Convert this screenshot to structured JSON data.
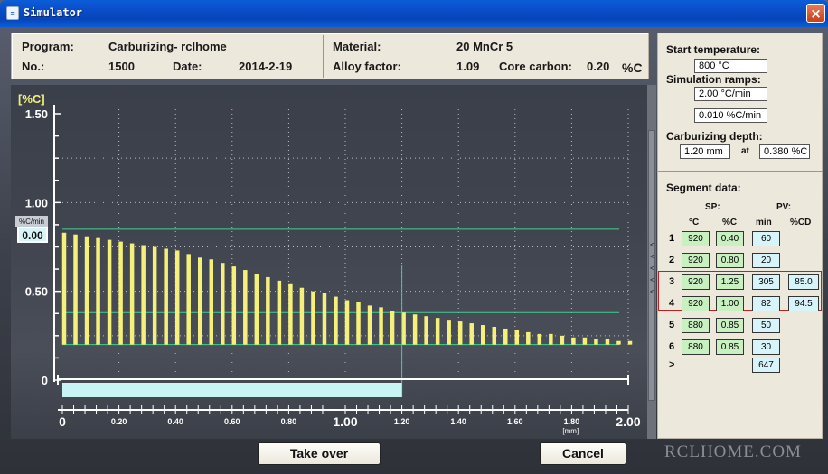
{
  "window": {
    "title": "Simulator",
    "close_glyph": "×"
  },
  "program_info": {
    "program_label": "Program:",
    "program_value": "Carburizing- rclhome",
    "no_label": "No.:",
    "no_value": "1500",
    "date_label": "Date:",
    "date_value": "2014-2-19",
    "material_label": "Material:",
    "material_value": "20 MnCr 5",
    "alloy_label": "Alloy factor:",
    "alloy_value": "1.09",
    "core_label": "Core carbon:",
    "core_value": "0.20",
    "core_unit": "%C"
  },
  "chart_data": {
    "type": "bar",
    "ylabel": "[%C]",
    "xlabel": "[mm]",
    "ylim": [
      0,
      1.5
    ],
    "xlim": [
      0,
      2.0
    ],
    "yticks": [
      "0",
      "0.50",
      "1.00",
      "1.50"
    ],
    "xticks": [
      "0",
      "0.20",
      "0.40",
      "0.60",
      "0.80",
      "1.00",
      "1.20",
      "1.40",
      "1.60",
      "1.80",
      "2.00"
    ],
    "rate_label": "%C/min",
    "rate_value": "0.00",
    "bars_x": [
      0.0,
      0.04,
      0.08,
      0.12,
      0.16,
      0.2,
      0.24,
      0.28,
      0.32,
      0.36,
      0.4,
      0.44,
      0.48,
      0.52,
      0.56,
      0.6,
      0.64,
      0.68,
      0.72,
      0.76,
      0.8,
      0.84,
      0.88,
      0.92,
      0.96,
      1.0,
      1.04,
      1.08,
      1.12,
      1.16,
      1.2,
      1.24,
      1.28,
      1.32,
      1.36,
      1.4,
      1.44,
      1.48,
      1.52,
      1.56,
      1.6,
      1.64,
      1.68,
      1.72,
      1.76,
      1.8,
      1.84,
      1.88,
      1.92,
      1.96,
      2.0
    ],
    "bars_y": [
      0.83,
      0.82,
      0.81,
      0.8,
      0.79,
      0.78,
      0.77,
      0.76,
      0.75,
      0.74,
      0.73,
      0.71,
      0.69,
      0.68,
      0.66,
      0.64,
      0.62,
      0.6,
      0.58,
      0.56,
      0.54,
      0.52,
      0.5,
      0.49,
      0.47,
      0.45,
      0.44,
      0.42,
      0.41,
      0.39,
      0.38,
      0.37,
      0.36,
      0.35,
      0.34,
      0.33,
      0.32,
      0.31,
      0.3,
      0.29,
      0.28,
      0.27,
      0.26,
      0.26,
      0.25,
      0.24,
      0.24,
      0.23,
      0.23,
      0.22,
      0.22
    ],
    "hlines": [
      0.85,
      0.38,
      0.2
    ],
    "vline_x": 1.2,
    "depth_bar_end": 1.2,
    "colors": {
      "bar": "#f4f07a",
      "green": "#3fd090",
      "depth": "#c8f4f6"
    }
  },
  "side": {
    "start_temp_label": "Start temperature:",
    "start_temp_value": "800 °C",
    "ramps_label": "Simulation ramps:",
    "ramp1": "2.00 °C/min",
    "ramp2": "0.010 %C/min",
    "depth_label": "Carburizing depth:",
    "depth_value": "1.20 mm",
    "at": "at",
    "depth_cd": "0.380 %C",
    "segment_label": "Segment data:",
    "sp_label": "SP:",
    "pv_label": "PV:",
    "col_c": "°C",
    "col_pc": "%C",
    "col_min": "min",
    "col_pcd": "%CD",
    "rows": [
      {
        "n": "1",
        "t": "920",
        "c": "0.40",
        "m": "60",
        "pv": ""
      },
      {
        "n": "2",
        "t": "920",
        "c": "0.80",
        "m": "20",
        "pv": ""
      },
      {
        "n": "3",
        "t": "920",
        "c": "1.25",
        "m": "305",
        "pv": "85.0"
      },
      {
        "n": "4",
        "t": "920",
        "c": "1.00",
        "m": "82",
        "pv": "94.5"
      },
      {
        "n": "5",
        "t": "880",
        "c": "0.85",
        "m": "50",
        "pv": ""
      },
      {
        "n": "6",
        "t": "880",
        "c": "0.85",
        "m": "30",
        "pv": ""
      }
    ],
    "total_arrow": ">",
    "total_value": "647"
  },
  "buttons": {
    "takeover": "Take over",
    "cancel": "Cancel"
  },
  "watermark": "RCLHOME.COM"
}
